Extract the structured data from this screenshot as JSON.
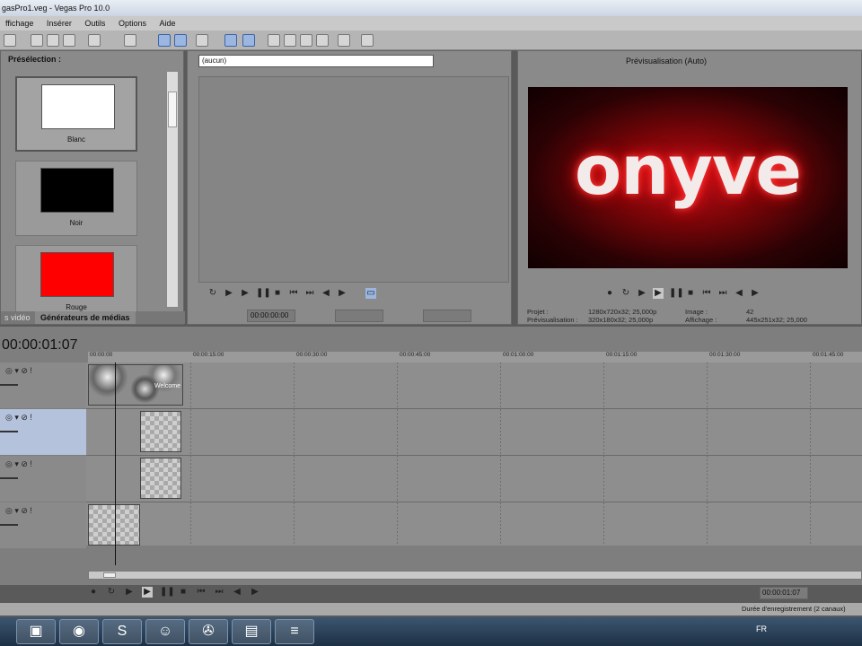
{
  "window": {
    "title": "gasPro1.veg - Vegas Pro 10.0"
  },
  "menu": [
    "ffichage",
    "Insérer",
    "Outils",
    "Options",
    "Aide"
  ],
  "media_generators": {
    "header": "Présélection :",
    "presets": [
      {
        "label": "Blanc",
        "color": "#ffffff"
      },
      {
        "label": "Noir",
        "color": "#000000"
      },
      {
        "label": "Rouge",
        "color": "#ff0000"
      }
    ],
    "tabs": [
      "s vidéo",
      "Générateurs de médias"
    ]
  },
  "trimmer": {
    "selection": "(aucun)",
    "time": "00:00:00:00"
  },
  "preview": {
    "mode_label": "Prévisualisation (Auto)",
    "overlay_text": "onyve",
    "info": {
      "projet_label": "Projet :",
      "projet_value": "1280x720x32; 25,000p",
      "previs_label": "Prévisualisation :",
      "previs_value": "320x180x32; 25,000p",
      "image_label": "Image :",
      "image_value": "42",
      "affichage_label": "Affichage :",
      "affichage_value": "445x251x32; 25,000"
    }
  },
  "timeline": {
    "timecode": "00:00:01:07",
    "ruler": [
      "00:00:00",
      "00:00:15:00",
      "00:00:30:00",
      "00:00:45:00",
      "00:01:00:00",
      "00:01:15:00",
      "00:01:30:00",
      "00:01:45:00"
    ],
    "clip_label": "Welcome"
  },
  "footer": {
    "time": "00:00:01:07",
    "status": "Durée d'enregistrement (2 canaux)",
    "language": "FR"
  }
}
